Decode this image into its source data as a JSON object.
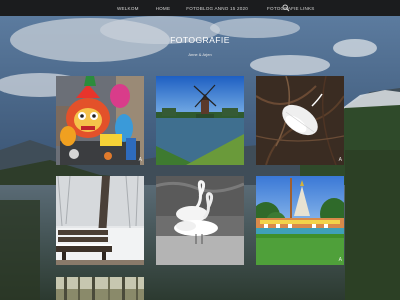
{
  "nav": {
    "items": [
      {
        "label": "Welkom"
      },
      {
        "label": "Home"
      },
      {
        "label": "Fotoblog Anno 15 2020"
      },
      {
        "label": "Fotografie links"
      }
    ],
    "search_icon": "search-icon"
  },
  "header": {
    "title": "FOTOGRAFIE",
    "subtitle": "Anne & Arjen"
  },
  "gallery": {
    "tiles": [
      {
        "subject": "carnival-float",
        "label": "A"
      },
      {
        "subject": "windmill",
        "label": ""
      },
      {
        "subject": "feather",
        "label": "A"
      },
      {
        "subject": "snowy-bench",
        "label": ""
      },
      {
        "subject": "swans",
        "label": ""
      },
      {
        "subject": "theme-park",
        "label": "A"
      },
      {
        "subject": "forest",
        "label": ""
      }
    ]
  },
  "colors": {
    "topbar": "#1b1c1e",
    "nav_text": "#d4d4d4",
    "title_text": "#ffffff"
  }
}
